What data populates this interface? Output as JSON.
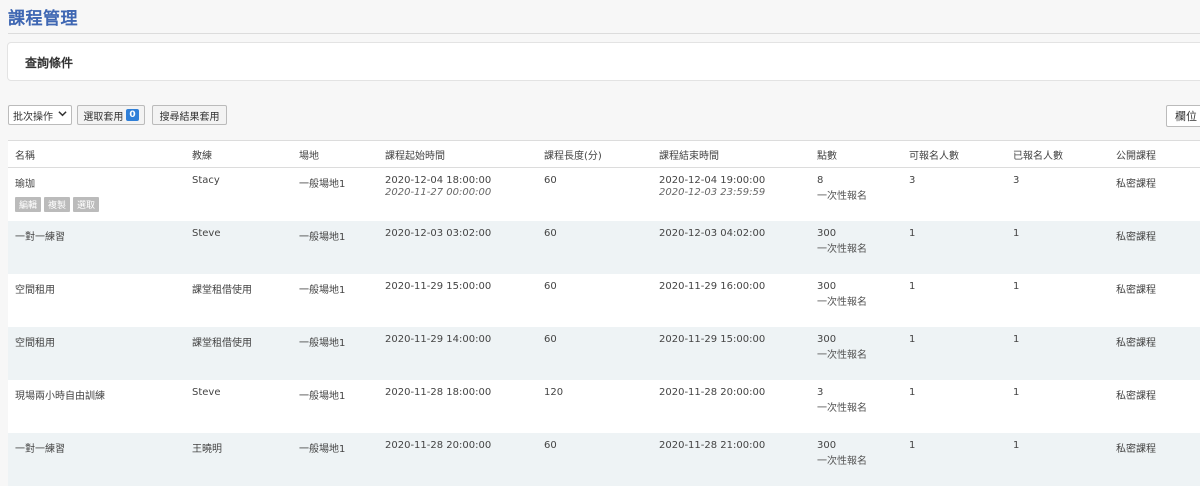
{
  "page": {
    "title": "課程管理"
  },
  "query": {
    "title": "查詢條件"
  },
  "toolbar": {
    "batch_select": "批次操作",
    "apply_selected": "選取套用",
    "selected_count": "0",
    "apply_search": "搜尋結果套用",
    "columns": "欄位"
  },
  "table": {
    "headers": [
      "名稱",
      "教練",
      "場地",
      "課程起始時間",
      "課程長度(分)",
      "課程結束時間",
      "點數",
      "可報名人數",
      "已報名人數",
      "公開課程"
    ],
    "row_actions": [
      "編輯",
      "複製",
      "選取"
    ],
    "rows": [
      {
        "name": "瑜珈",
        "coach": "Stacy",
        "venue": "一般場地1",
        "start": "2020-12-04 18:00:00",
        "start_sub": "2020-11-27 00:00:00",
        "length": "60",
        "end": "2020-12-04 19:00:00",
        "end_sub": "2020-12-03 23:59:59",
        "points": "8",
        "points_sub": "一次性報名",
        "capacity": "3",
        "enrolled": "3",
        "public": "私密課程"
      },
      {
        "name": "一對一練習",
        "coach": "Steve",
        "venue": "一般場地1",
        "start": "2020-12-03 03:02:00",
        "start_sub": "",
        "length": "60",
        "end": "2020-12-03 04:02:00",
        "end_sub": "",
        "points": "300",
        "points_sub": "一次性報名",
        "capacity": "1",
        "enrolled": "1",
        "public": "私密課程"
      },
      {
        "name": "空間租用",
        "coach": "課堂租借使用",
        "venue": "一般場地1",
        "start": "2020-11-29 15:00:00",
        "start_sub": "",
        "length": "60",
        "end": "2020-11-29 16:00:00",
        "end_sub": "",
        "points": "300",
        "points_sub": "一次性報名",
        "capacity": "1",
        "enrolled": "1",
        "public": "私密課程"
      },
      {
        "name": "空間租用",
        "coach": "課堂租借使用",
        "venue": "一般場地1",
        "start": "2020-11-29 14:00:00",
        "start_sub": "",
        "length": "60",
        "end": "2020-11-29 15:00:00",
        "end_sub": "",
        "points": "300",
        "points_sub": "一次性報名",
        "capacity": "1",
        "enrolled": "1",
        "public": "私密課程"
      },
      {
        "name": "現場兩小時自由訓練",
        "coach": "Steve",
        "venue": "一般場地1",
        "start": "2020-11-28 18:00:00",
        "start_sub": "",
        "length": "120",
        "end": "2020-11-28 20:00:00",
        "end_sub": "",
        "points": "3",
        "points_sub": "一次性報名",
        "capacity": "1",
        "enrolled": "1",
        "public": "私密課程"
      },
      {
        "name": "一對一練習",
        "coach": "王曉明",
        "venue": "一般場地1",
        "start": "2020-11-28 20:00:00",
        "start_sub": "",
        "length": "60",
        "end": "2020-11-28 21:00:00",
        "end_sub": "",
        "points": "300",
        "points_sub": "一次性報名",
        "capacity": "1",
        "enrolled": "1",
        "public": "私密課程"
      }
    ]
  }
}
